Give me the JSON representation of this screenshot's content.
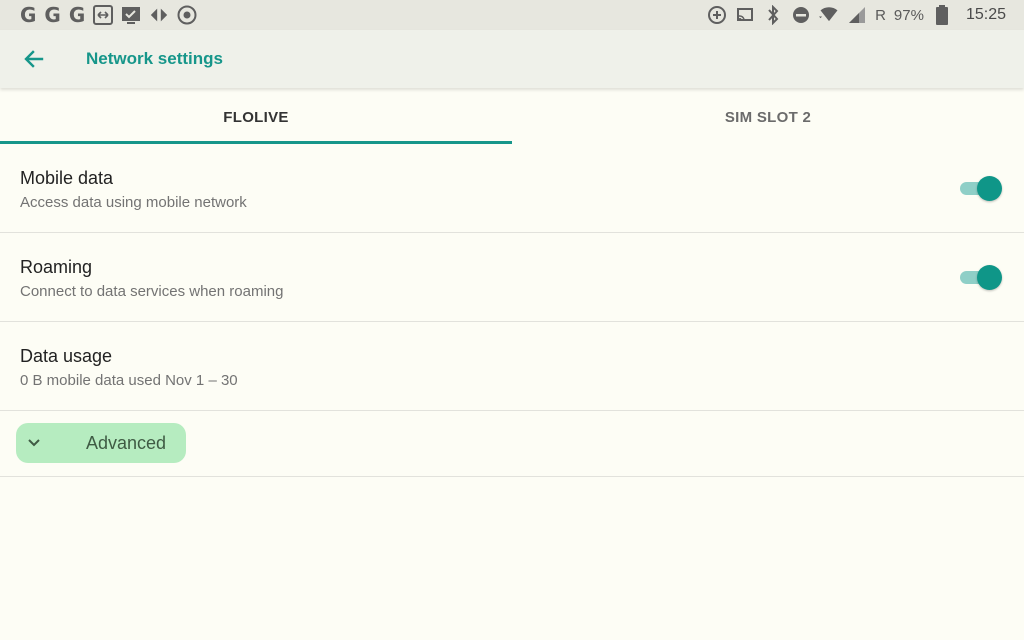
{
  "status_bar": {
    "left_icons": [
      "G",
      "G",
      "G"
    ],
    "battery": "97%",
    "roaming_indicator": "R",
    "time": "15:25"
  },
  "appbar": {
    "title": "Network settings"
  },
  "tabs": [
    {
      "label": "FLOLIVE",
      "active": true
    },
    {
      "label": "SIM SLOT 2",
      "active": false
    }
  ],
  "settings": {
    "mobile_data": {
      "title": "Mobile data",
      "summary": "Access data using mobile network",
      "enabled": true
    },
    "roaming": {
      "title": "Roaming",
      "summary": "Connect to data services when roaming",
      "enabled": true
    },
    "data_usage": {
      "title": "Data usage",
      "summary": "0 B mobile data used Nov 1 – 30"
    },
    "advanced": {
      "label": "Advanced"
    }
  },
  "colors": {
    "accent": "#16968a",
    "background": "#fdfdf5",
    "advanced_highlight": "#b6ecc0"
  }
}
